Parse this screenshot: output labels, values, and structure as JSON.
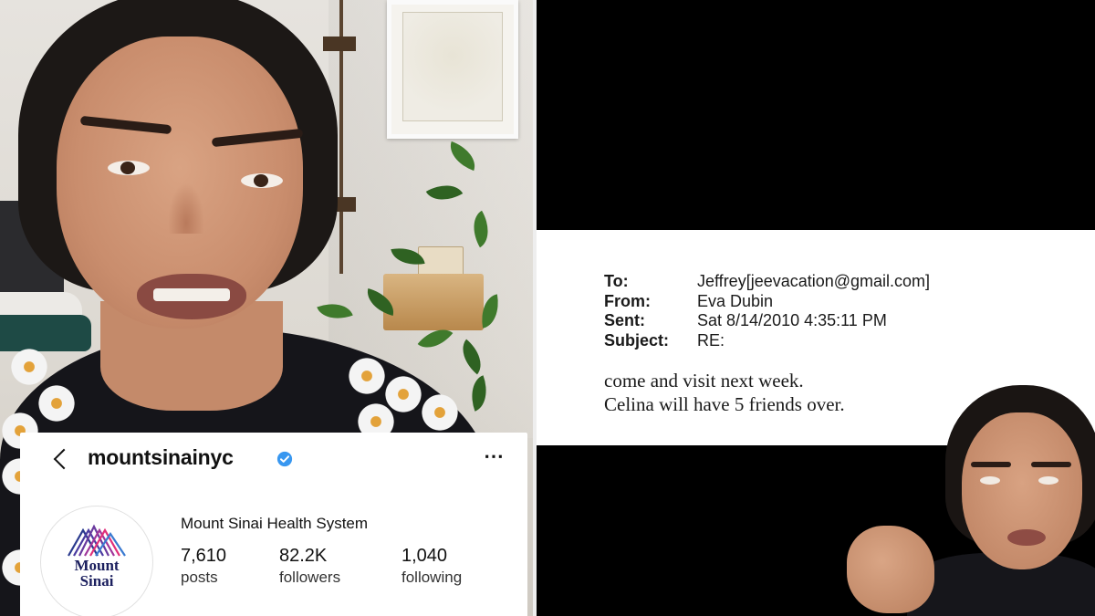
{
  "instagram": {
    "handle": "mountsinainyc",
    "verified": true,
    "more_icon": "⋯",
    "profile_name": "Mount Sinai Health System",
    "logo_text_line1": "Mount",
    "logo_text_line2": "Sinai",
    "stats": [
      {
        "value": "7,610",
        "label": "posts"
      },
      {
        "value": "82.2K",
        "label": "followers"
      },
      {
        "value": "1,040",
        "label": "following"
      }
    ],
    "accent_color": "#3897f0",
    "logo_colors": [
      "#e0307a",
      "#2a3a8e",
      "#6a3a9e"
    ]
  },
  "email": {
    "to_label": "To:",
    "to_value": "Jeffrey[jeevacation@gmail.com]",
    "from_label": "From:",
    "from_value": "Eva Dubin",
    "sent_label": "Sent:",
    "sent_value": "Sat 8/14/2010 4:35:11 PM",
    "subject_label": "Subject:",
    "subject_value": "RE:",
    "body_line1": "come and visit next week.",
    "body_line2": "Celina will have 5 friends over."
  }
}
